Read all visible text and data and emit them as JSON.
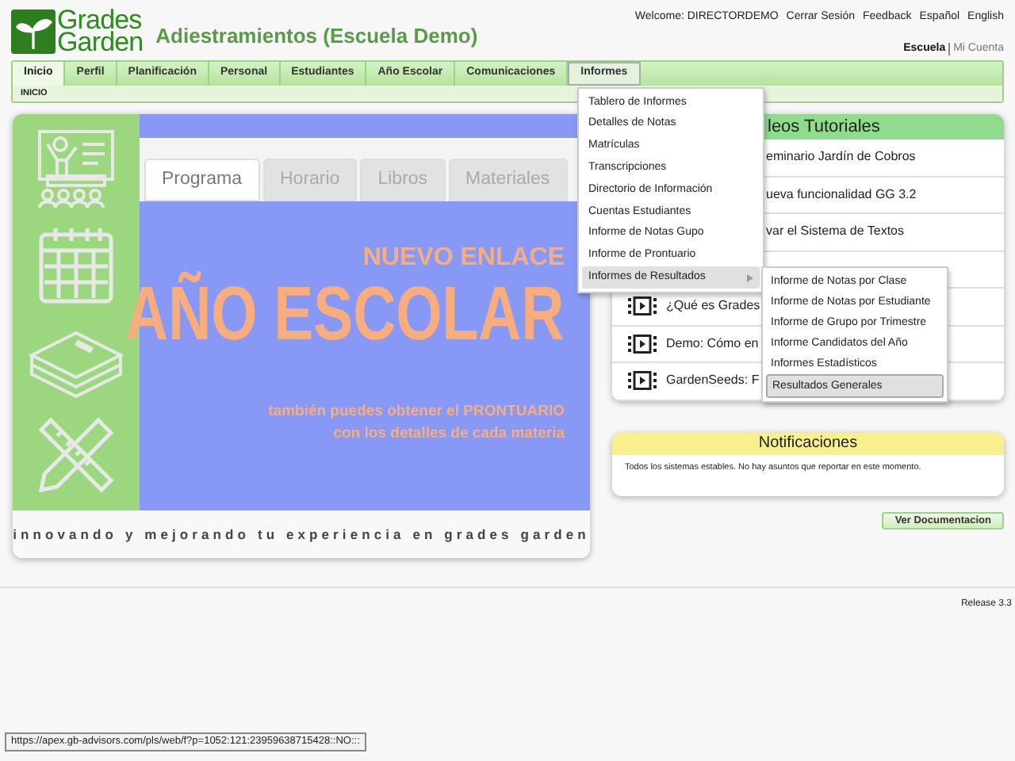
{
  "logo": {
    "line1": "Grades",
    "line2": "Garden"
  },
  "title": "Adiestramientos (Escuela Demo)",
  "top_links": [
    "Welcome: DIRECTORDEMO",
    "Cerrar Sesión",
    "Feedback",
    "Español",
    "English"
  ],
  "account_links": [
    {
      "label": "Escuela",
      "selected": true
    },
    {
      "label": "Mi Cuenta",
      "selected": false
    }
  ],
  "nav_tabs": [
    {
      "label": "Inicio",
      "selected": true,
      "open": false
    },
    {
      "label": "Perfil",
      "selected": false,
      "open": false
    },
    {
      "label": "Planificación",
      "selected": false,
      "open": false
    },
    {
      "label": "Personal",
      "selected": false,
      "open": false
    },
    {
      "label": "Estudiantes",
      "selected": false,
      "open": false
    },
    {
      "label": "Año Escolar",
      "selected": false,
      "open": false
    },
    {
      "label": "Comunicaciones",
      "selected": false,
      "open": false
    },
    {
      "label": "Informes",
      "selected": false,
      "open": true
    }
  ],
  "breadcrumb": "INICIO",
  "banner": {
    "tabs": [
      {
        "label": "Programa",
        "selected": true
      },
      {
        "label": "Horario",
        "selected": false
      },
      {
        "label": "Libros",
        "selected": false
      },
      {
        "label": "Materiales",
        "selected": false
      }
    ],
    "kicker": "NUEVO ENLACE",
    "headline": "AÑO ESCOLAR",
    "subline1": "también puedes obtener el PRONTUARIO",
    "subline2": "con los detalles de cada materia",
    "footer": "innovando y mejorando tu experiencia en grades garden"
  },
  "videos": {
    "title": "leos Tutoriales",
    "items": [
      {
        "kind": "partial",
        "label": "eminario Jardín de Cobros"
      },
      {
        "kind": "partial",
        "label": "ueva funcionalidad GG 3.2"
      },
      {
        "kind": "partial",
        "label": "var el Sistema de Textos"
      },
      {
        "kind": "hidden"
      },
      {
        "kind": "video",
        "label": "¿Qué es Grades"
      },
      {
        "kind": "video",
        "label": "Demo: Cómo en"
      },
      {
        "kind": "video",
        "label": "GardenSeeds: F"
      }
    ]
  },
  "notifications": {
    "title": "Notificaciones",
    "message": "Todos los sistemas estables. No hay asuntos que reportar en este momento."
  },
  "doc_button": "Ver Documentacion",
  "release": "Release 3.3",
  "status_url": "https://apex.gb-advisors.com/pls/web/f?p=1052:121:23959638715428::NO:::",
  "informes_menu": [
    {
      "label": "Tablero de Informes",
      "selected": false,
      "submenu": false
    },
    {
      "label": "Detalles de Notas",
      "selected": false,
      "submenu": false
    },
    {
      "label": "Matrículas",
      "selected": false,
      "submenu": false
    },
    {
      "label": "Transcripciones",
      "selected": false,
      "submenu": false
    },
    {
      "label": "Directorio de Información",
      "selected": false,
      "submenu": false
    },
    {
      "label": "Cuentas Estudiantes",
      "selected": false,
      "submenu": false
    },
    {
      "label": "Informe de Notas Gupo",
      "selected": false,
      "submenu": false
    },
    {
      "label": "Informe de Prontuario",
      "selected": false,
      "submenu": false
    },
    {
      "label": "Informes de Resultados",
      "selected": true,
      "submenu": true
    }
  ],
  "resultados_menu": [
    {
      "label": "Informe de Notas por Clase",
      "selected": false
    },
    {
      "label": "Informe de Notas por Estudiante",
      "selected": false
    },
    {
      "label": "Informe de Grupo por Trimestre",
      "selected": false
    },
    {
      "label": "Informe Candidatos del Año",
      "selected": false
    },
    {
      "label": "Informes Estadísticos",
      "selected": false
    },
    {
      "label": "Resultados Generales",
      "selected": true
    }
  ]
}
